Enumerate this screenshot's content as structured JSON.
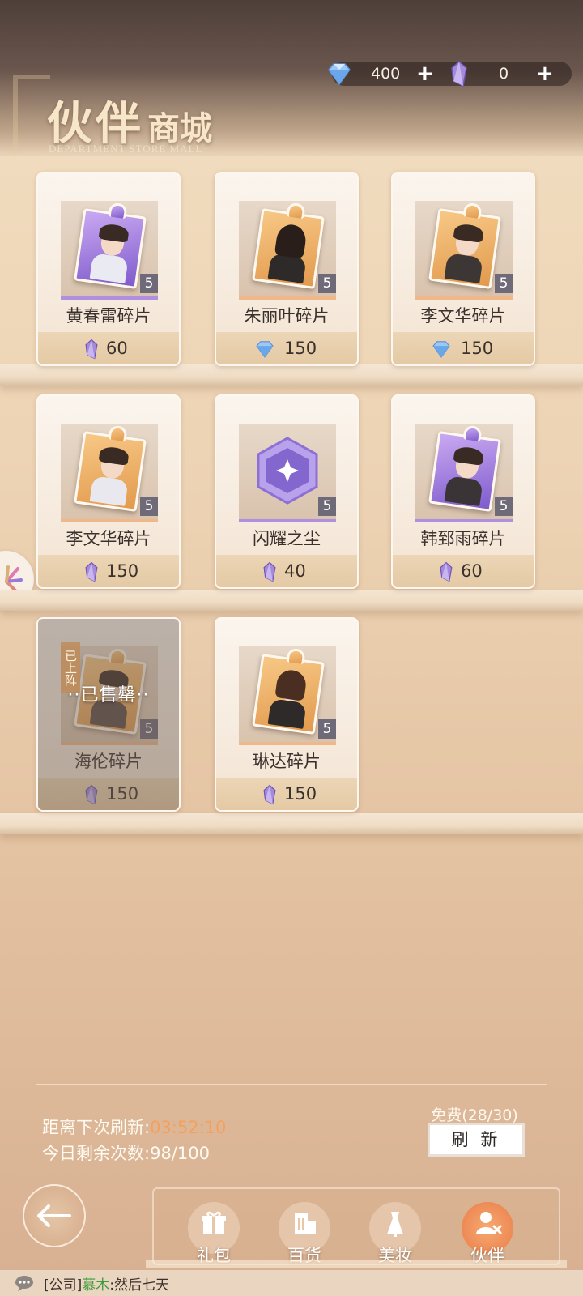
{
  "header": {
    "title_main": "伙伴",
    "title_sub": "商城",
    "title_en": "DEPARTMENT STORE MALL"
  },
  "currency": {
    "diamond": "400",
    "crystal": "0",
    "plus": "+"
  },
  "items": [
    {
      "name": "黄春雷碎片",
      "count": "5",
      "price": "60",
      "currency": "crystal",
      "rarity": "purple",
      "sold": false
    },
    {
      "name": "朱丽叶碎片",
      "count": "5",
      "price": "150",
      "currency": "diamond",
      "rarity": "gold",
      "sold": false
    },
    {
      "name": "李文华碎片",
      "count": "5",
      "price": "150",
      "currency": "diamond",
      "rarity": "gold",
      "sold": false
    },
    {
      "name": "李文华碎片",
      "count": "5",
      "price": "150",
      "currency": "crystal",
      "rarity": "gold",
      "sold": false
    },
    {
      "name": "闪耀之尘",
      "count": "5",
      "price": "40",
      "currency": "crystal",
      "rarity": "purple",
      "sold": false
    },
    {
      "name": "韩郅雨碎片",
      "count": "5",
      "price": "60",
      "currency": "crystal",
      "rarity": "purple",
      "sold": false
    },
    {
      "name": "海伦碎片",
      "count": "5",
      "price": "150",
      "currency": "crystal",
      "rarity": "gold",
      "sold": true,
      "sold_label": "··已售罄··",
      "tag": "已上阵"
    },
    {
      "name": "琳达碎片",
      "count": "5",
      "price": "150",
      "currency": "crystal",
      "rarity": "gold",
      "sold": false
    }
  ],
  "refresh": {
    "next_label": "距离下次刷新:",
    "timer": "03:52:10",
    "remaining_label": "今日剩余次数:",
    "remaining": "98/100",
    "free": "免费(28/30)",
    "button": "刷 新"
  },
  "nav": [
    {
      "label": "礼包",
      "icon": "gift-icon",
      "active": false
    },
    {
      "label": "百货",
      "icon": "store-icon",
      "active": false
    },
    {
      "label": "美妆",
      "icon": "dress-icon",
      "active": false
    },
    {
      "label": "伙伴",
      "icon": "partner-icon",
      "active": true
    }
  ],
  "chat": {
    "channel": "[公司]",
    "user": "慕木",
    "separator": ":",
    "message": "然后七天"
  },
  "colors": {
    "accent_orange": "#f3a15c",
    "active_tab": "#ee8a55",
    "chat_user": "#3c9c3c"
  }
}
